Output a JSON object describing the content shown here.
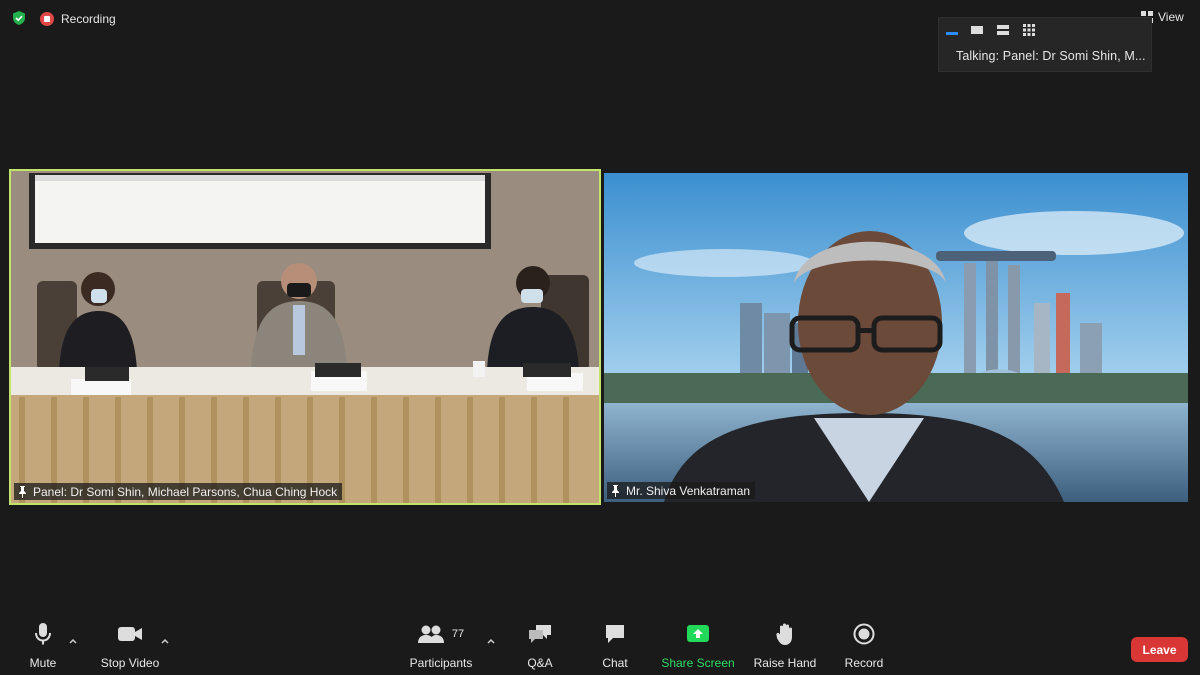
{
  "top": {
    "recording_label": "Recording",
    "view_label": "View"
  },
  "layout_popup": {
    "talking_text": "Talking: Panel: Dr Somi Shin, M..."
  },
  "videos": [
    {
      "name": "Panel: Dr Somi Shin, Michael Parsons, Chua Ching Hock",
      "active_speaker": true
    },
    {
      "name": "Mr. Shiva Venkatraman",
      "active_speaker": false
    }
  ],
  "toolbar": {
    "mute_label": "Mute",
    "stop_video_label": "Stop Video",
    "participants_label": "Participants",
    "participants_count": "77",
    "qa_label": "Q&A",
    "chat_label": "Chat",
    "share_screen_label": "Share Screen",
    "raise_hand_label": "Raise Hand",
    "record_label": "Record",
    "leave_label": "Leave"
  },
  "colors": {
    "background": "#1a1a1a",
    "active_speaker_border": "#c3e36a",
    "share_screen_green": "#23d959",
    "leave_red": "#d93636",
    "recording_red": "#e04848",
    "encryption_green": "#23b14d"
  }
}
